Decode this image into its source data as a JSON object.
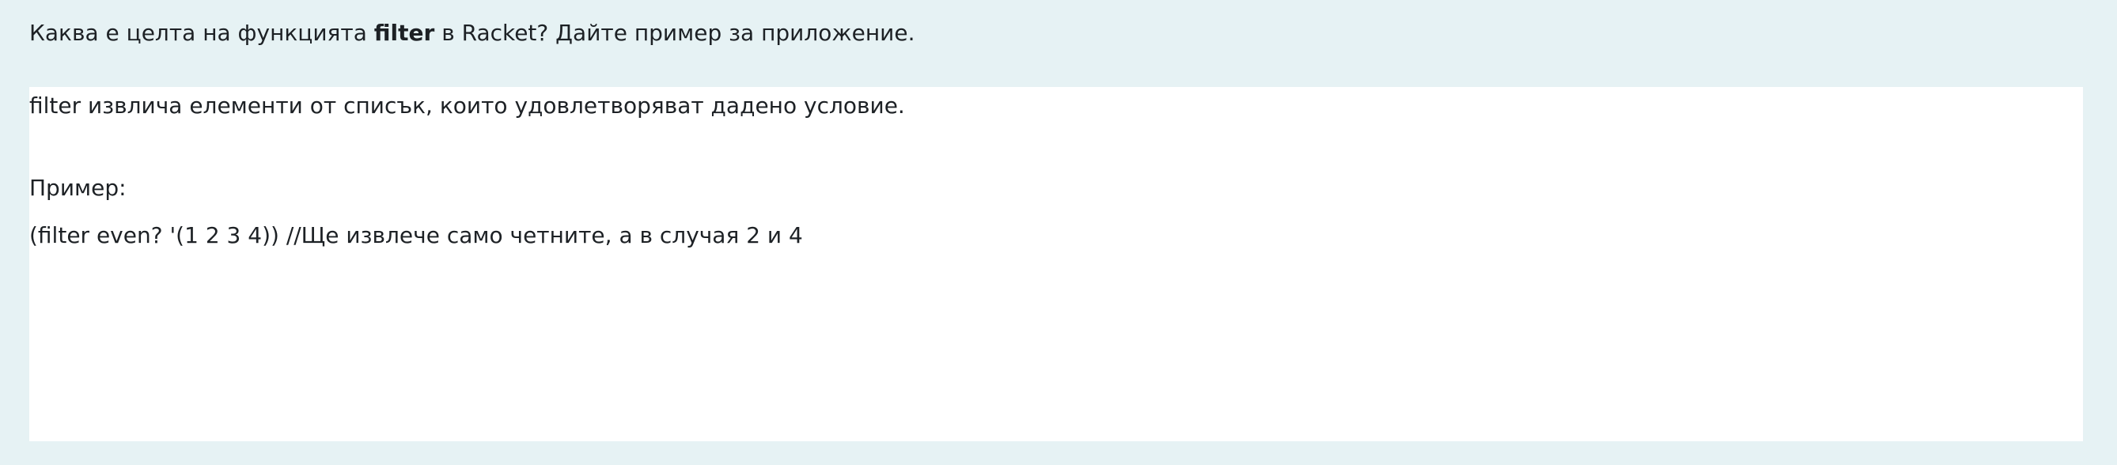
{
  "question": {
    "prefix": "Каква е целта на функцията ",
    "keyword": "filter",
    "suffix": " в Racket? Дайте пример за приложение."
  },
  "answer": {
    "lines": [
      "filter извлича елементи от списък, които удовлетворяват дадено условие.",
      "Пример:",
      "(filter even? '(1 2 3 4)) //Ще извлече само четните, а в случая 2 и 4"
    ]
  }
}
